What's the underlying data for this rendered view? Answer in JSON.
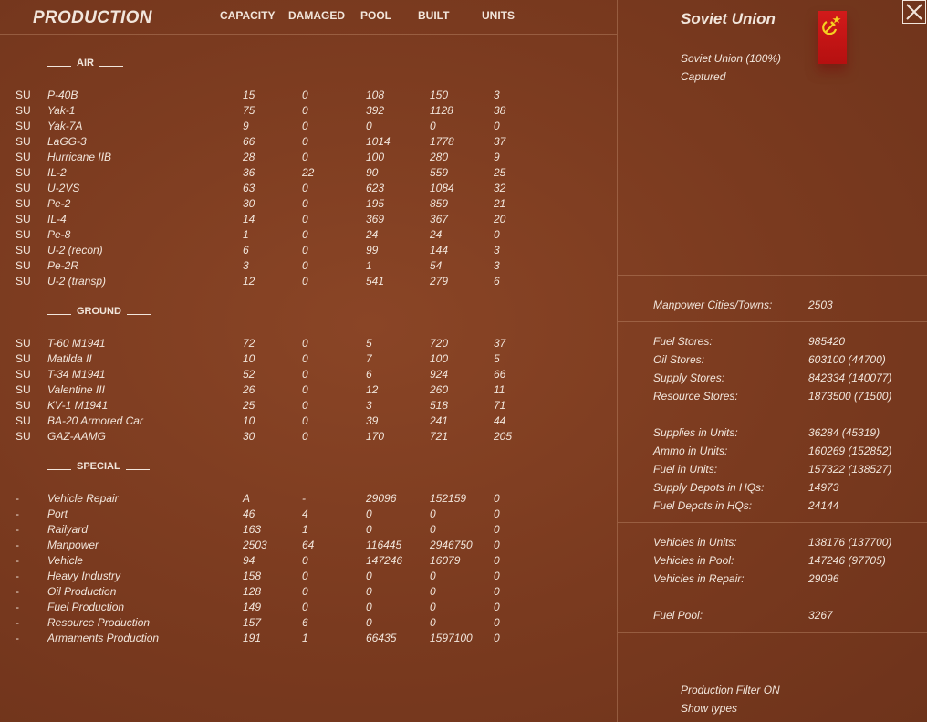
{
  "production": {
    "title": "PRODUCTION",
    "columns": {
      "capacity": "CAPACITY",
      "damaged": "DAMAGED",
      "pool": "POOL",
      "built": "BUILT",
      "units": "UNITS"
    },
    "sections": {
      "air": "AIR",
      "ground": "GROUND",
      "special": "SPECIAL"
    },
    "air": [
      [
        "SU",
        "P-40B",
        "15",
        "0",
        "108",
        "150",
        "3"
      ],
      [
        "SU",
        "Yak-1",
        "75",
        "0",
        "392",
        "1128",
        "38"
      ],
      [
        "SU",
        "Yak-7A",
        "9",
        "0",
        "0",
        "0",
        "0"
      ],
      [
        "SU",
        "LaGG-3",
        "66",
        "0",
        "1014",
        "1778",
        "37"
      ],
      [
        "SU",
        "Hurricane IIB",
        "28",
        "0",
        "100",
        "280",
        "9"
      ],
      [
        "SU",
        "IL-2",
        "36",
        "22",
        "90",
        "559",
        "25"
      ],
      [
        "SU",
        "U-2VS",
        "63",
        "0",
        "623",
        "1084",
        "32"
      ],
      [
        "SU",
        "Pe-2",
        "30",
        "0",
        "195",
        "859",
        "21"
      ],
      [
        "SU",
        "IL-4",
        "14",
        "0",
        "369",
        "367",
        "20"
      ],
      [
        "SU",
        "Pe-8",
        "1",
        "0",
        "24",
        "24",
        "0"
      ],
      [
        "SU",
        "U-2 (recon)",
        "6",
        "0",
        "99",
        "144",
        "3"
      ],
      [
        "SU",
        "Pe-2R",
        "3",
        "0",
        "1",
        "54",
        "3"
      ],
      [
        "SU",
        "U-2 (transp)",
        "12",
        "0",
        "541",
        "279",
        "6"
      ]
    ],
    "ground": [
      [
        "SU",
        "T-60 M1941",
        "72",
        "0",
        "5",
        "720",
        "37"
      ],
      [
        "SU",
        "Matilda II",
        "10",
        "0",
        "7",
        "100",
        "5"
      ],
      [
        "SU",
        "T-34 M1941",
        "52",
        "0",
        "6",
        "924",
        "66"
      ],
      [
        "SU",
        "Valentine III",
        "26",
        "0",
        "12",
        "260",
        "11"
      ],
      [
        "SU",
        "KV-1 M1941",
        "25",
        "0",
        "3",
        "518",
        "71"
      ],
      [
        "SU",
        "BA-20 Armored Car",
        "10",
        "0",
        "39",
        "241",
        "44"
      ],
      [
        "SU",
        "GAZ-AAMG",
        "30",
        "0",
        "170",
        "721",
        "205"
      ]
    ],
    "special": [
      [
        "-",
        "Vehicle Repair",
        "A",
        "-",
        "29096",
        "152159",
        "0"
      ],
      [
        "-",
        "Port",
        "46",
        "4",
        "0",
        "0",
        "0"
      ],
      [
        "-",
        "Railyard",
        "163",
        "1",
        "0",
        "0",
        "0"
      ],
      [
        "-",
        "Manpower",
        "2503",
        "64",
        "116445",
        "2946750",
        "0"
      ],
      [
        "-",
        "Vehicle",
        "94",
        "0",
        "147246",
        "16079",
        "0"
      ],
      [
        "-",
        "Heavy Industry",
        "158",
        "0",
        "0",
        "0",
        "0"
      ],
      [
        "-",
        "Oil Production",
        "128",
        "0",
        "0",
        "0",
        "0"
      ],
      [
        "-",
        "Fuel Production",
        "149",
        "0",
        "0",
        "0",
        "0"
      ],
      [
        "-",
        "Resource Production",
        "157",
        "6",
        "0",
        "0",
        "0"
      ],
      [
        "-",
        "Armaments Production",
        "191",
        "1",
        "66435",
        "1597100",
        "0"
      ]
    ]
  },
  "nation": {
    "name": "Soviet Union",
    "control": "Soviet Union  (100%)",
    "status": "Captured",
    "flag_color": "#cc1414",
    "flag_icon": "hammer-sickle-star"
  },
  "stats": {
    "manpower": [
      [
        "Manpower Cities/Towns:",
        "2503"
      ]
    ],
    "stores": [
      [
        "Fuel Stores:",
        "985420"
      ],
      [
        "Oil Stores:",
        "603100 (44700)"
      ],
      [
        "Supply Stores:",
        "842334 (140077)"
      ],
      [
        "Resource Stores:",
        "1873500 (71500)"
      ]
    ],
    "units": [
      [
        "Supplies in Units:",
        "36284 (45319)"
      ],
      [
        "Ammo in Units:",
        "160269 (152852)"
      ],
      [
        "Fuel in Units:",
        "157322 (138527)"
      ],
      [
        "Supply Depots in HQs:",
        "14973"
      ],
      [
        "Fuel Depots in HQs:",
        "24144"
      ]
    ],
    "vehicles": [
      [
        "Vehicles in Units:",
        "138176 (137700)"
      ],
      [
        "Vehicles in Pool:",
        "147246 (97705)"
      ],
      [
        "Vehicles in Repair:",
        "29096"
      ]
    ],
    "fuel_pool": [
      [
        "Fuel Pool:",
        "3267"
      ]
    ]
  },
  "filters": {
    "production_filter": "Production Filter ON",
    "show_types": "Show types"
  }
}
